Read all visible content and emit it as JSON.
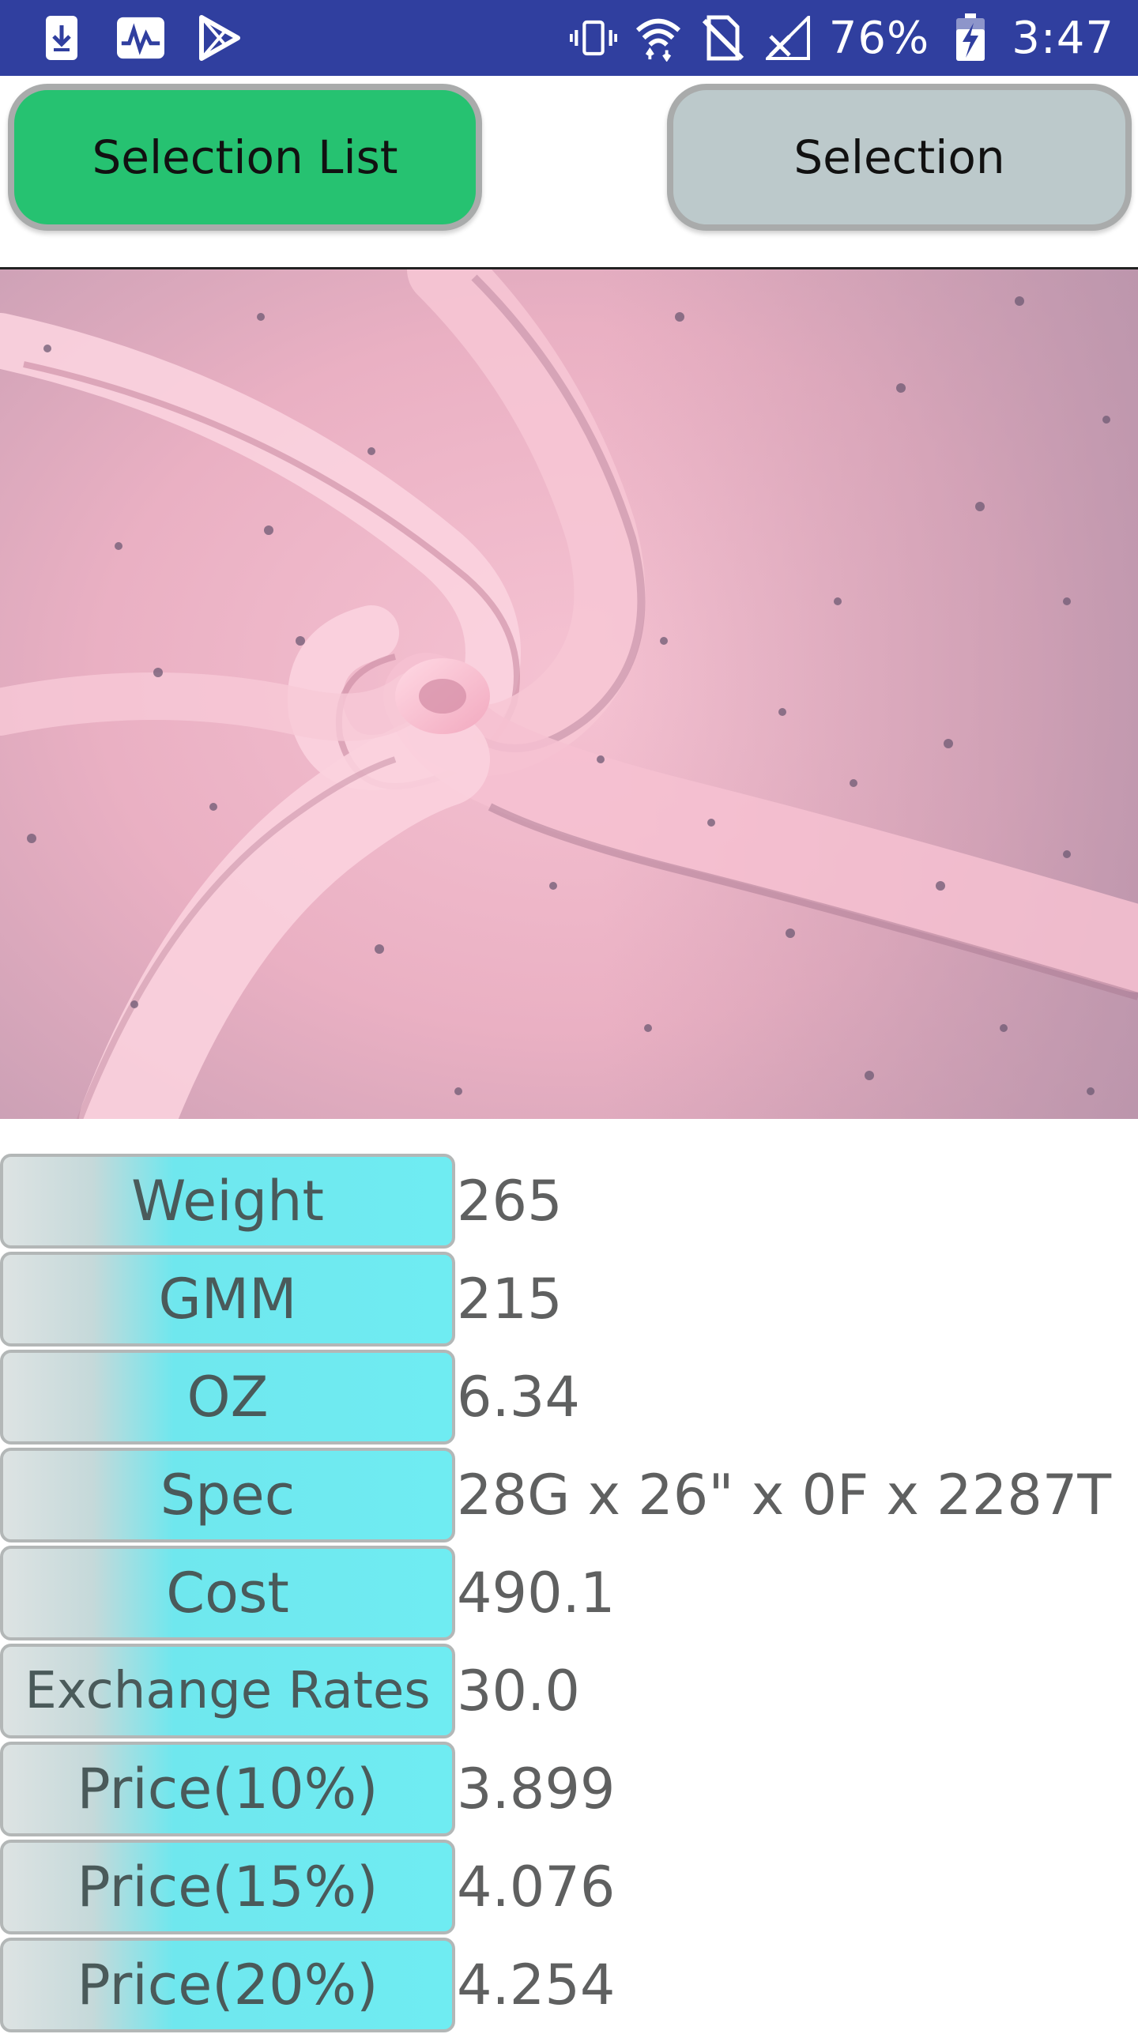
{
  "status_bar": {
    "left_icons": [
      "download-icon",
      "activity-chart-icon",
      "play-store-icon"
    ],
    "right_icons": [
      "vibrate-icon",
      "wifi-icon",
      "no-sim-icon",
      "signal-icon"
    ],
    "battery": "76%",
    "time": "3:47"
  },
  "toolbar": {
    "selection_list_label": "Selection List",
    "selection_label": "Selection",
    "selection_list_color": "#26c271",
    "selection_color": "#bcc9cb"
  },
  "colors": {
    "status_bar": "#303f9f",
    "label_cyan": "#6fecf2",
    "fabric_pink": "#f3b3c7"
  },
  "details": [
    {
      "label": "Weight",
      "value": "265"
    },
    {
      "label": "GMM",
      "value": "215"
    },
    {
      "label": "OZ",
      "value": "6.34"
    },
    {
      "label": "Spec",
      "value": "28G x 26\" x 0F x 2287T"
    },
    {
      "label": "Cost",
      "value": "490.1"
    },
    {
      "label": "Exchange Rates",
      "value": "30.0"
    },
    {
      "label": "Price(10%)",
      "value": "3.899"
    },
    {
      "label": "Price(15%)",
      "value": "4.076"
    },
    {
      "label": "Price(20%)",
      "value": "4.254"
    }
  ]
}
